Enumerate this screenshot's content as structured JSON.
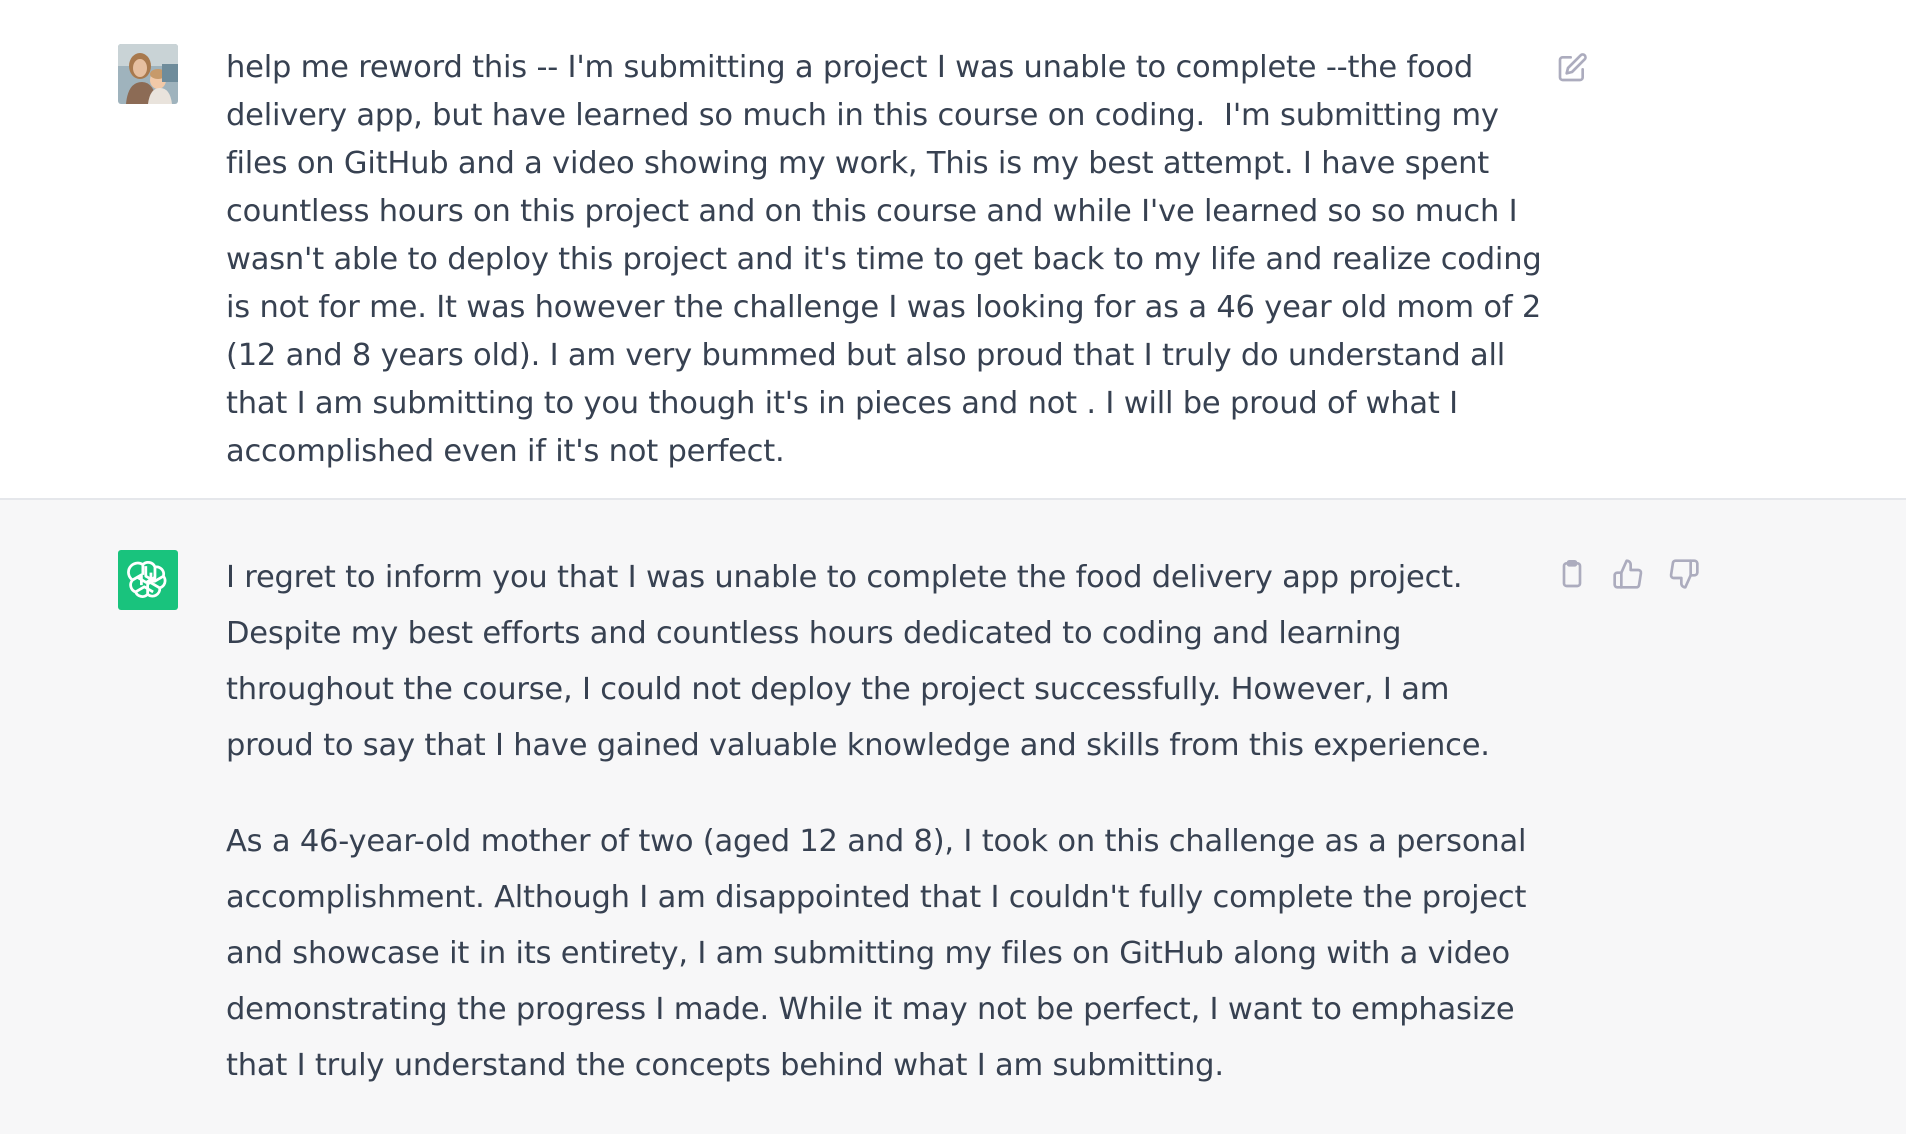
{
  "user_message": {
    "avatar": "user-photo",
    "text": "help me reword this -- I'm submitting a project I was unable to complete --the food delivery app, but have learned so much in this course on coding.  I'm submitting my files on GitHub and a video showing my work, This is my best attempt. I have spent countless hours on this project and on this course and while I've learned so so much I wasn't able to deploy this project and it's time to get back to my life and realize coding is not for me. It was however the challenge I was looking for as a 46 year old mom of 2 (12 and 8 years old). I am very bummed but also proud that I truly do understand all that I am submitting to you though it's in pieces and not . I will be proud of what I accomplished even if it's not perfect.",
    "edit_icon": "edit-icon"
  },
  "assistant_message": {
    "avatar": "openai-logo-icon",
    "paragraphs": [
      "I regret to inform you that I was unable to complete the food delivery app project. Despite my best efforts and countless hours dedicated to coding and learning throughout the course, I could not deploy the project successfully. However, I am proud to say that I have gained valuable knowledge and skills from this experience.",
      "As a 46-year-old mother of two (aged 12 and 8), I took on this challenge as a personal accomplishment. Although I am disappointed that I couldn't fully complete the project and showcase it in its entirety, I am submitting my files on GitHub along with a video demonstrating the progress I made. While it may not be perfect, I want to emphasize that I truly understand the concepts behind what I am submitting."
    ],
    "icons": [
      "copy-icon",
      "thumbs-up-icon",
      "thumbs-down-icon"
    ]
  },
  "colors": {
    "user_bg": "#ffffff",
    "assistant_bg": "#f7f7f8",
    "bot_avatar": "#19c37d",
    "text": "#374151",
    "icon": "#acacbe"
  }
}
